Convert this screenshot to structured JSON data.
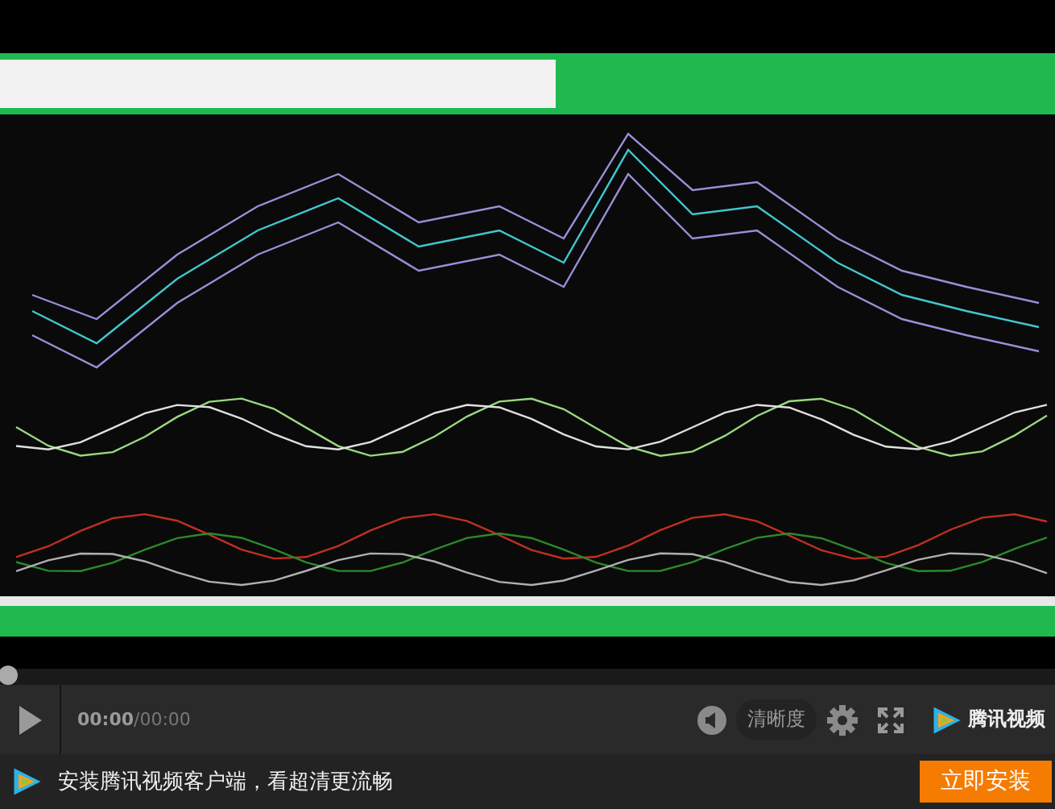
{
  "progress": {
    "level": 0
  },
  "controls": {
    "time_current": "00:00",
    "time_total": "/00:00",
    "quality_label": "清晰度",
    "brand": "腾讯视频"
  },
  "promo": {
    "text": "安装腾讯视频客户端，看超清更流畅",
    "install_button": "立即安装"
  }
}
